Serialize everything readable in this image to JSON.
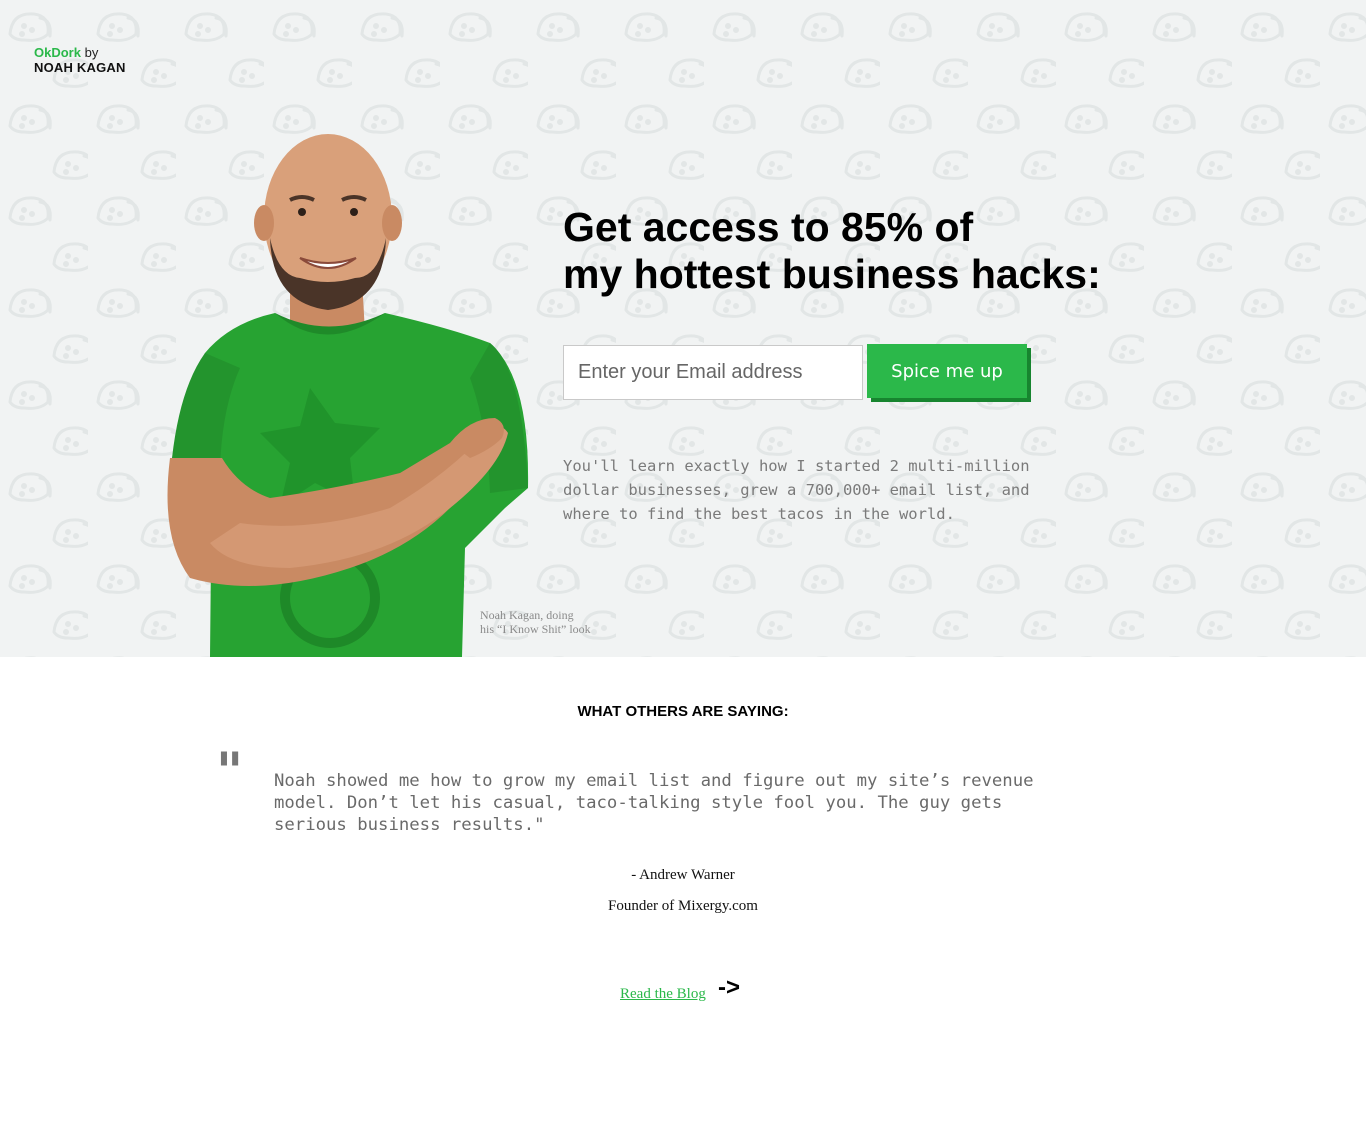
{
  "header": {
    "brand": "OkDork",
    "by": "by",
    "author_name": "NOAH KAGAN"
  },
  "hero": {
    "headline_line1": "Get access to 85% of",
    "headline_line2": "my hottest business hacks:",
    "email_placeholder": "Enter your Email address",
    "email_value": "",
    "cta_label": "Spice me up",
    "blurb": "You'll learn exactly how I started 2 multi-million dollar businesses, grew a 700,000+ email list, and where to find the best tacos in the world.",
    "caption_line1": "Noah Kagan, doing",
    "caption_line2": "his “I Know Shit” look"
  },
  "testimonials": {
    "title": "WHAT OTHERS ARE SAYING:",
    "quote_mark": "\"",
    "quote": "Noah showed me how to grow my email list and figure out my site’s revenue model. Don’t let his casual, taco-talking style fool you. The guy gets serious business results.\"",
    "author": "- Andrew Warner",
    "role": "Founder of Mixergy.com"
  },
  "footer": {
    "blog_link": "Read the Blog",
    "arrow": "->"
  },
  "colors": {
    "accent": "#2bb84a",
    "accent_shadow": "#17852f",
    "hero_bg": "#f1f3f3"
  }
}
